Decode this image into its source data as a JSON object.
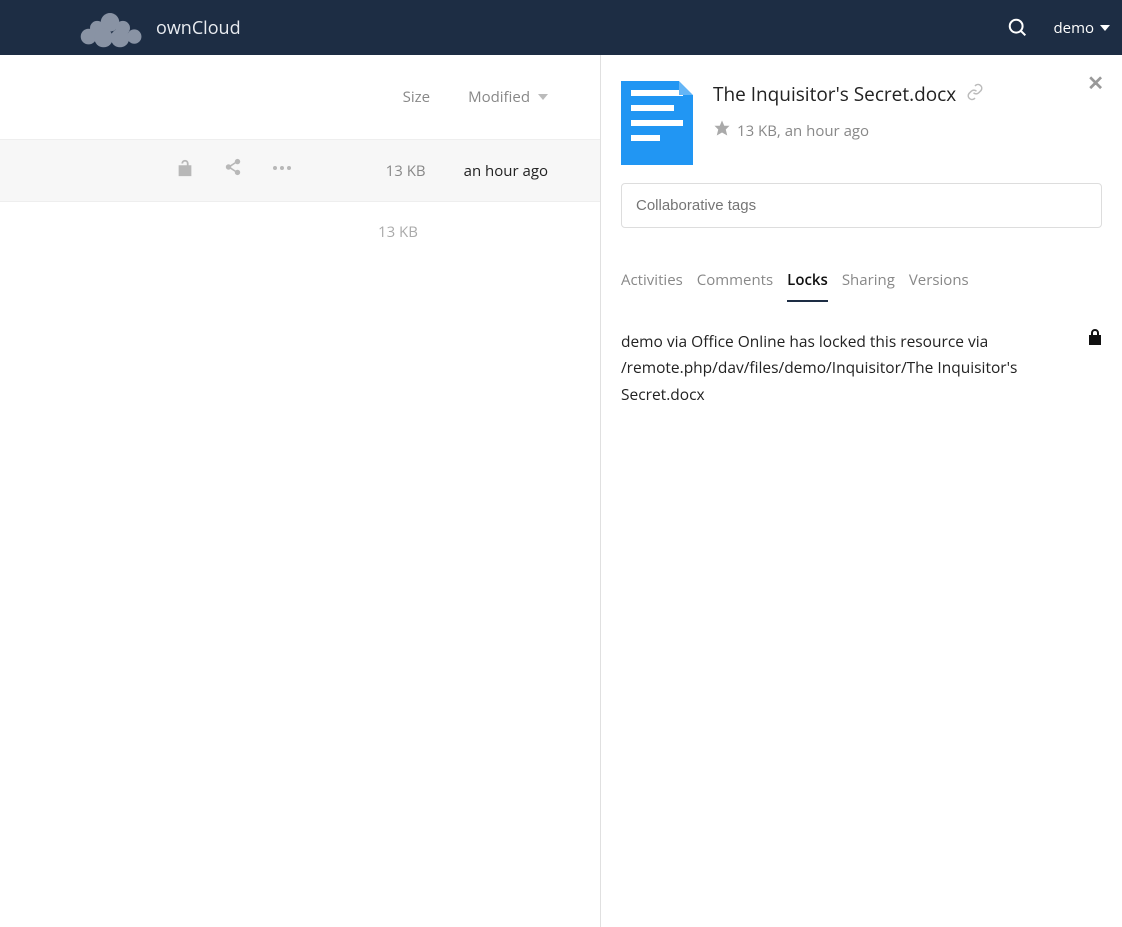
{
  "brand": "ownCloud",
  "user": "demo",
  "headers": {
    "size": "Size",
    "modified": "Modified"
  },
  "row": {
    "size": "13 KB",
    "modified": "an hour ago"
  },
  "summary": {
    "size": "13 KB"
  },
  "detail": {
    "filename": "The Inquisitor's Secret.docx",
    "meta": "13 KB, an hour ago",
    "tags_placeholder": "Collaborative tags"
  },
  "tabs": {
    "activities": "Activities",
    "comments": "Comments",
    "locks": "Locks",
    "sharing": "Sharing",
    "versions": "Versions"
  },
  "lock_message": "demo via Office Online has locked this resource via /remote.php/dav/files/demo/Inquisitor/The Inquisitor's Secret.docx"
}
